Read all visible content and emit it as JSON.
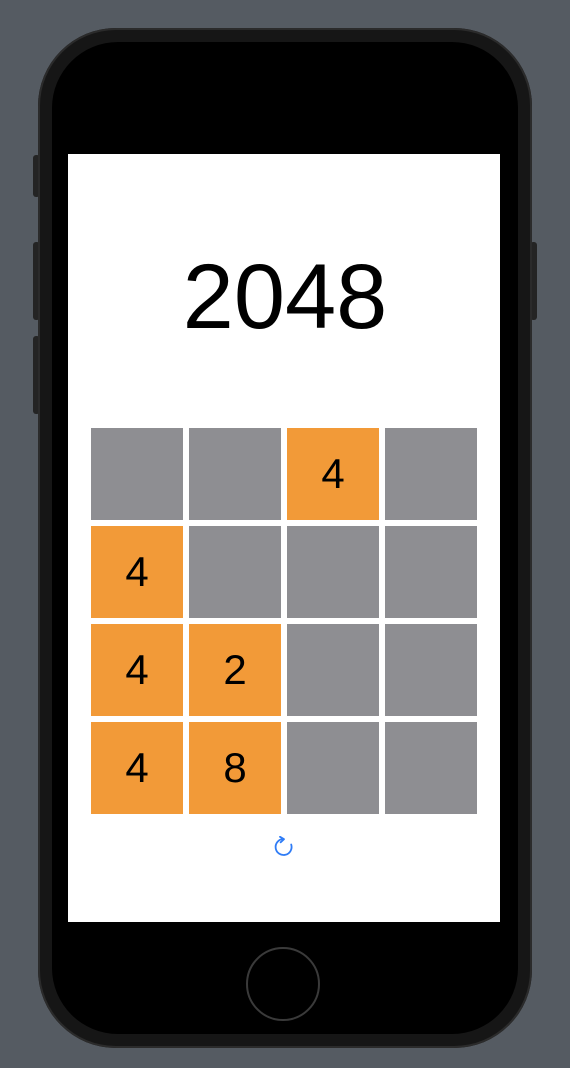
{
  "game": {
    "title": "2048"
  },
  "board": {
    "rows": [
      [
        "",
        "",
        "4",
        ""
      ],
      [
        "4",
        "",
        "",
        ""
      ],
      [
        "4",
        "2",
        "",
        ""
      ],
      [
        "4",
        "8",
        "",
        ""
      ]
    ]
  },
  "icons": {
    "restart": "restart-icon"
  },
  "colors": {
    "empty_tile": "#8e8e92",
    "filled_tile": "#f29a38",
    "accent": "#2f7cf6",
    "device_background": "#555b62"
  }
}
